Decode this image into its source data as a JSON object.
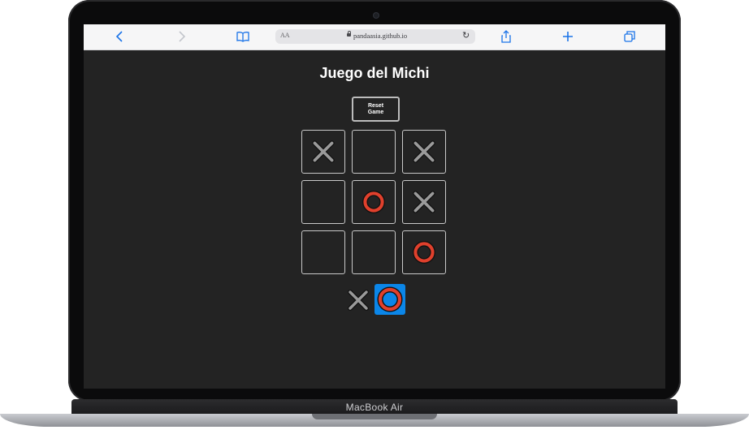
{
  "device": {
    "label": "MacBook Air"
  },
  "browser": {
    "address_prefix": "AA",
    "url": "pandaasia.github.io",
    "back_icon": "chevron-left-icon",
    "forward_icon": "chevron-right-icon",
    "bookmarks_icon": "book-icon",
    "share_icon": "share-icon",
    "new_tab_icon": "plus-icon",
    "tabs_icon": "tabs-icon",
    "reload_icon": "reload-icon",
    "accent": "#1a73e8"
  },
  "page": {
    "title": "Juego del Michi",
    "reset_label": "Reset Game",
    "background": "#232323"
  },
  "board": {
    "cells": [
      "X",
      "",
      "X",
      "",
      "O",
      "X",
      "",
      "",
      "O"
    ],
    "x_color": "#9a9a9a",
    "o_color": "#e0402c"
  },
  "turn_indicator": {
    "players": [
      "X",
      "O"
    ],
    "current": "O",
    "active_color": "#0b86e8"
  }
}
